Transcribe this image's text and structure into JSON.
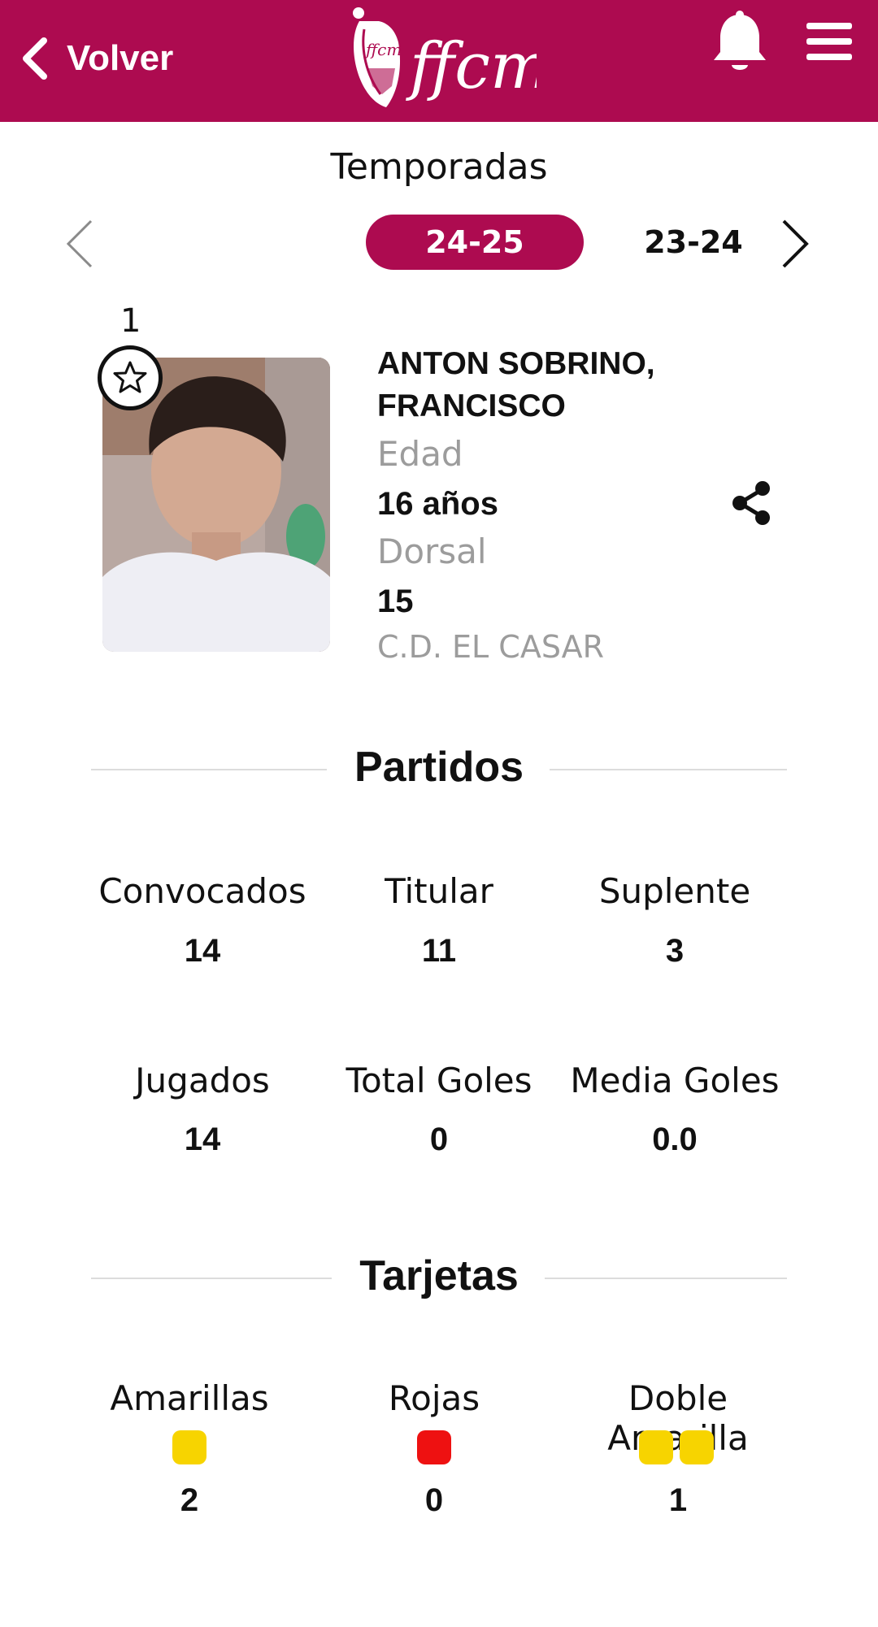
{
  "header": {
    "back_label": "Volver",
    "logo_text": "ffcm",
    "brand_color": "#ad0b50"
  },
  "seasons": {
    "title": "Temporadas",
    "active": "24-25",
    "next": "23-24"
  },
  "player": {
    "rank": "1",
    "name_line1": "ANTON SOBRINO,",
    "name_line2": "FRANCISCO",
    "age_label": "Edad",
    "age_value": "16 años",
    "dorsal_label": "Dorsal",
    "dorsal_value": "15",
    "club": "C.D. EL CASAR"
  },
  "partidos": {
    "title": "Partidos",
    "stats": [
      {
        "label": "Convocados",
        "value": "14"
      },
      {
        "label": "Titular",
        "value": "11"
      },
      {
        "label": "Suplente",
        "value": "3"
      },
      {
        "label": "Jugados",
        "value": "14"
      },
      {
        "label": "Total Goles",
        "value": "0"
      },
      {
        "label": "Media Goles",
        "value": "0.0"
      }
    ]
  },
  "tarjetas": {
    "title": "Tarjetas",
    "stats": [
      {
        "label": "Amarillas",
        "value": "2",
        "color": "#f7d400"
      },
      {
        "label": "Rojas",
        "value": "0",
        "color": "#ee1111"
      },
      {
        "label": "Doble Amarilla",
        "value": "1",
        "color": "#f7d400"
      }
    ]
  },
  "icons": [
    "chevron-left-icon",
    "ffcm-logo",
    "bell-icon",
    "menu-icon",
    "star-icon",
    "share-icon",
    "chevron-right-icon"
  ]
}
